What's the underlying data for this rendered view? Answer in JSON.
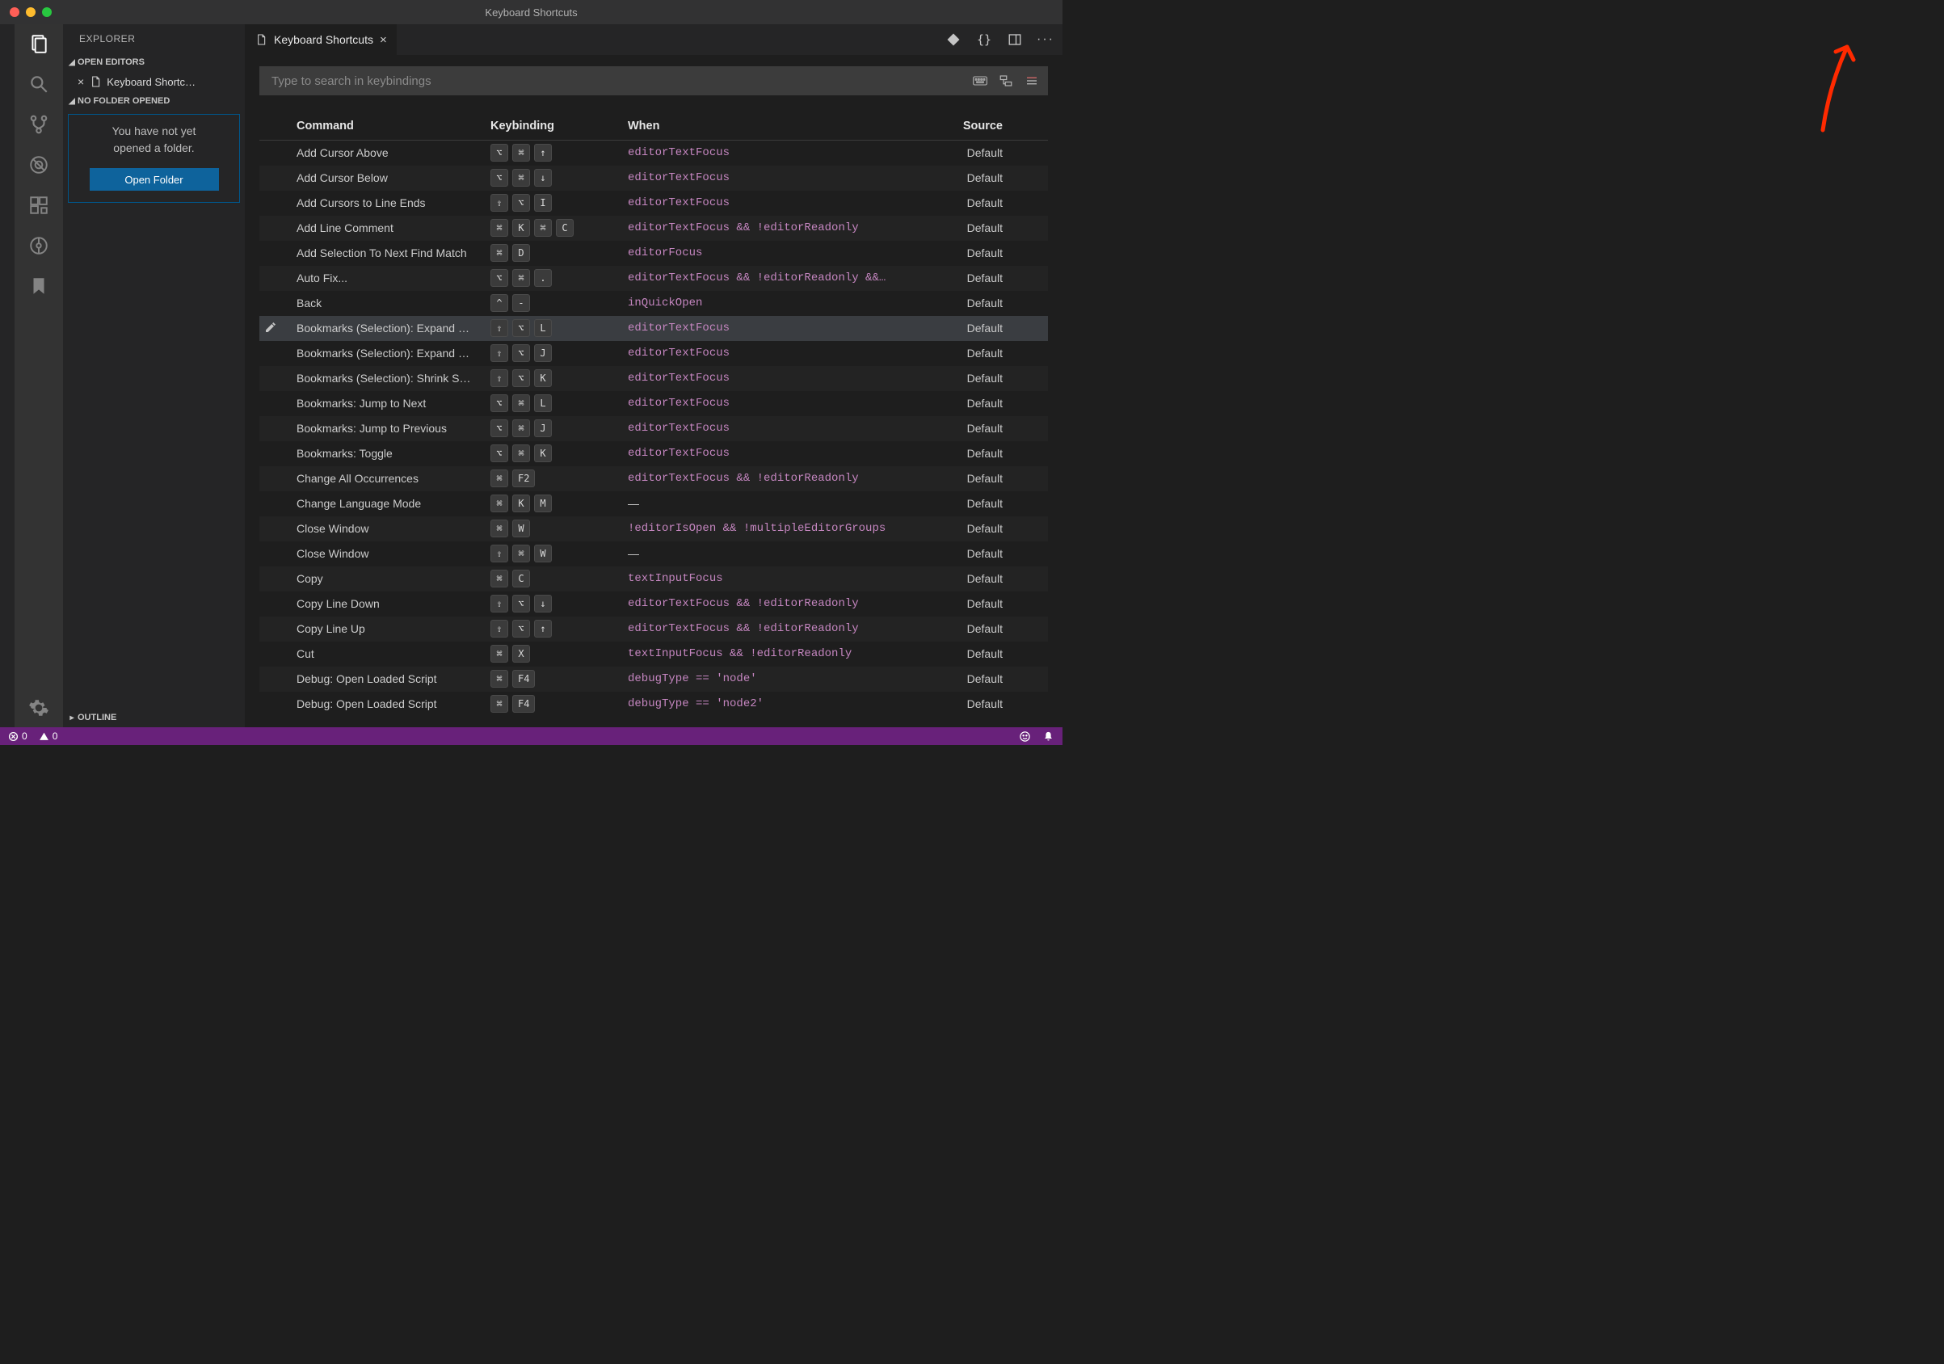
{
  "window": {
    "title": "Keyboard Shortcuts"
  },
  "sidebar": {
    "title": "EXPLORER",
    "sections": {
      "openEditors": {
        "label": "OPEN EDITORS"
      },
      "noFolder": {
        "label": "NO FOLDER OPENED"
      },
      "outline": {
        "label": "OUTLINE"
      }
    },
    "openEditorItem": "Keyboard Shortc…",
    "noFolder": {
      "line1": "You have not yet",
      "line2": "opened a folder.",
      "button": "Open Folder"
    }
  },
  "tab": {
    "label": "Keyboard Shortcuts"
  },
  "search": {
    "placeholder": "Type to search in keybindings"
  },
  "columns": {
    "command": "Command",
    "keybinding": "Keybinding",
    "when": "When",
    "source": "Source"
  },
  "source_default": "Default",
  "rows": [
    {
      "cmd": "Add Cursor Above",
      "keys": [
        "⌥",
        "⌘",
        "↑"
      ],
      "when": "editorTextFocus",
      "src": "Default"
    },
    {
      "cmd": "Add Cursor Below",
      "keys": [
        "⌥",
        "⌘",
        "↓"
      ],
      "when": "editorTextFocus",
      "src": "Default"
    },
    {
      "cmd": "Add Cursors to Line Ends",
      "keys": [
        "⇧",
        "⌥",
        "I"
      ],
      "when": "editorTextFocus",
      "src": "Default"
    },
    {
      "cmd": "Add Line Comment",
      "keys": [
        "⌘",
        "K",
        "⌘",
        "C"
      ],
      "when": "editorTextFocus && !editorReadonly",
      "src": "Default"
    },
    {
      "cmd": "Add Selection To Next Find Match",
      "keys": [
        "⌘",
        "D"
      ],
      "when": "editorFocus",
      "src": "Default"
    },
    {
      "cmd": "Auto Fix...",
      "keys": [
        "⌥",
        "⌘",
        "."
      ],
      "when": "editorTextFocus && !editorReadonly &&…",
      "src": "Default"
    },
    {
      "cmd": "Back",
      "keys": [
        "^",
        "-"
      ],
      "when": "inQuickOpen",
      "src": "Default"
    },
    {
      "cmd": "Bookmarks (Selection): Expand …",
      "keys": [
        "⇧",
        "⌥",
        "L"
      ],
      "when": "editorTextFocus",
      "src": "Default",
      "selected": true
    },
    {
      "cmd": "Bookmarks (Selection): Expand …",
      "keys": [
        "⇧",
        "⌥",
        "J"
      ],
      "when": "editorTextFocus",
      "src": "Default"
    },
    {
      "cmd": "Bookmarks (Selection): Shrink S…",
      "keys": [
        "⇧",
        "⌥",
        "K"
      ],
      "when": "editorTextFocus",
      "src": "Default"
    },
    {
      "cmd": "Bookmarks: Jump to Next",
      "keys": [
        "⌥",
        "⌘",
        "L"
      ],
      "when": "editorTextFocus",
      "src": "Default"
    },
    {
      "cmd": "Bookmarks: Jump to Previous",
      "keys": [
        "⌥",
        "⌘",
        "J"
      ],
      "when": "editorTextFocus",
      "src": "Default"
    },
    {
      "cmd": "Bookmarks: Toggle",
      "keys": [
        "⌥",
        "⌘",
        "K"
      ],
      "when": "editorTextFocus",
      "src": "Default"
    },
    {
      "cmd": "Change All Occurrences",
      "keys": [
        "⌘",
        "F2"
      ],
      "when": "editorTextFocus && !editorReadonly",
      "src": "Default"
    },
    {
      "cmd": "Change Language Mode",
      "keys": [
        "⌘",
        "K",
        "M"
      ],
      "when": "—",
      "src": "Default"
    },
    {
      "cmd": "Close Window",
      "keys": [
        "⌘",
        "W"
      ],
      "when": "!editorIsOpen && !multipleEditorGroups",
      "src": "Default"
    },
    {
      "cmd": "Close Window",
      "keys": [
        "⇧",
        "⌘",
        "W"
      ],
      "when": "—",
      "src": "Default"
    },
    {
      "cmd": "Copy",
      "keys": [
        "⌘",
        "C"
      ],
      "when": "textInputFocus",
      "src": "Default"
    },
    {
      "cmd": "Copy Line Down",
      "keys": [
        "⇧",
        "⌥",
        "↓"
      ],
      "when": "editorTextFocus && !editorReadonly",
      "src": "Default"
    },
    {
      "cmd": "Copy Line Up",
      "keys": [
        "⇧",
        "⌥",
        "↑"
      ],
      "when": "editorTextFocus && !editorReadonly",
      "src": "Default"
    },
    {
      "cmd": "Cut",
      "keys": [
        "⌘",
        "X"
      ],
      "when": "textInputFocus && !editorReadonly",
      "src": "Default"
    },
    {
      "cmd": "Debug: Open Loaded Script",
      "keys": [
        "⌘",
        "F4"
      ],
      "when": "debugType == 'node'",
      "src": "Default"
    },
    {
      "cmd": "Debug: Open Loaded Script",
      "keys": [
        "⌘",
        "F4"
      ],
      "when": "debugType == 'node2'",
      "src": "Default"
    }
  ],
  "statusbar": {
    "errors": "0",
    "warnings": "0"
  }
}
